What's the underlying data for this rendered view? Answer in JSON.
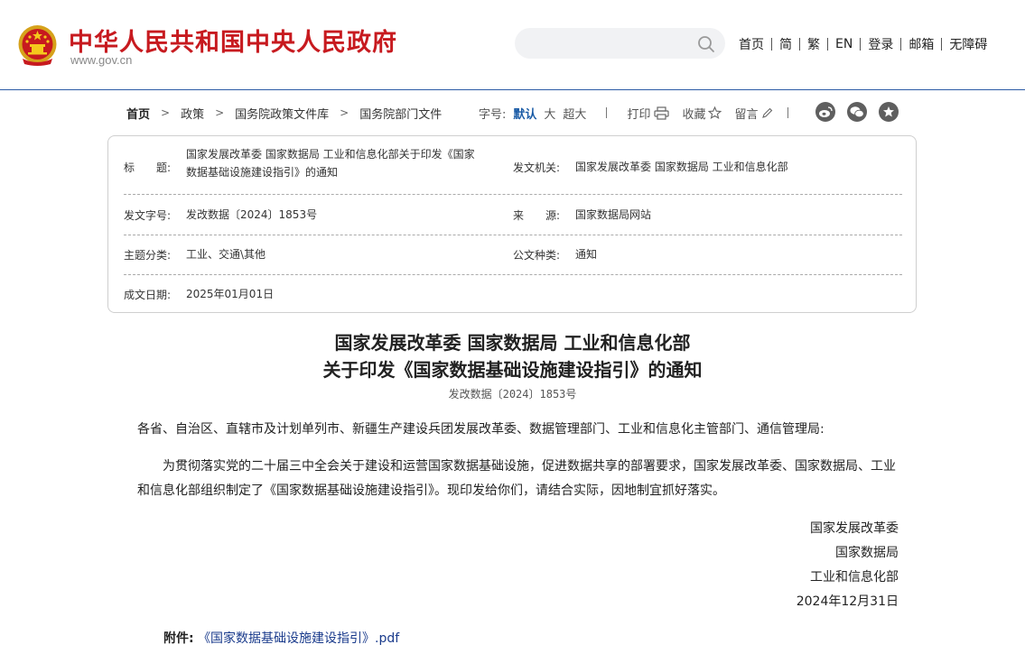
{
  "header": {
    "site_name": "中华人民共和国中央人民政府",
    "site_url": "www.gov.cn",
    "search_placeholder": "",
    "nav": [
      "首页",
      "简",
      "繁",
      "EN",
      "登录",
      "邮箱",
      "无障碍"
    ]
  },
  "breadcrumb": {
    "items": [
      "首页",
      "政策",
      "国务院政策文件库",
      "国务院部门文件"
    ]
  },
  "tools": {
    "font_label": "字号:",
    "font_default": "默认",
    "font_large": "大",
    "font_xlarge": "超大",
    "print": "打印",
    "favorite": "收藏",
    "comment": "留言"
  },
  "social_icons": [
    "weibo-icon",
    "wechat-icon",
    "star-icon"
  ],
  "info": {
    "title_label": "标　　题:",
    "title_value_line1": "国家发展改革委 国家数据局 工业和信息化部关于印发《国家",
    "title_value_line2": "数据基础设施建设指引》的通知",
    "issuer_label": "发文机关:",
    "issuer_value": "国家发展改革委 国家数据局 工业和信息化部",
    "docno_label": "发文字号:",
    "docno_value": "发改数据〔2024〕1853号",
    "source_label": "来　　源:",
    "source_value": "国家数据局网站",
    "topic_label": "主题分类:",
    "topic_value": "工业、交通\\其他",
    "type_label": "公文种类:",
    "type_value": "通知",
    "date_label": "成文日期:",
    "date_value": "2025年01月01日"
  },
  "document": {
    "title_line1": "国家发展改革委 国家数据局 工业和信息化部",
    "title_line2": "关于印发《国家数据基础设施建设指引》的通知",
    "doc_number": "发改数据〔2024〕1853号",
    "salutation": "各省、自治区、直辖市及计划单列市、新疆生产建设兵团发展改革委、数据管理部门、工业和信息化主管部门、通信管理局:",
    "body_line1": "　　为贯彻落实党的二十届三中全会关于建设和运营国家数据基础设施，促进数据共享的部署要求，国家发展改革委、国家数据局、工业",
    "body_line2": "和信息化部组织制定了《国家数据基础设施建设指引》。现印发给你们，请结合实际，因地制宜抓好落实。",
    "signatures": [
      "国家发展改革委",
      "国家数据局",
      "工业和信息化部"
    ],
    "sign_date": "2024年12月31日",
    "attachment_label": "附件:",
    "attachment_link": "《国家数据基础设施建设指引》.pdf"
  },
  "colors": {
    "brand_red": "#c71a1f",
    "link_blue": "#1a5ba6",
    "header_rule": "#2b5aa5"
  }
}
